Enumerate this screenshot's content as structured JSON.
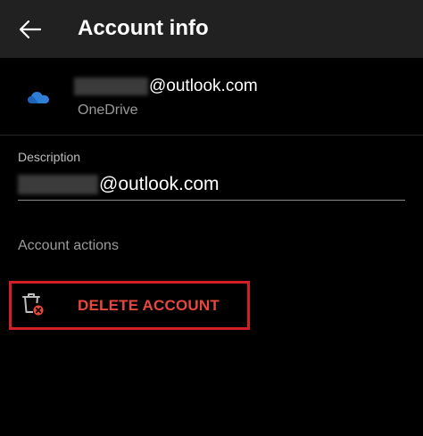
{
  "app_bar": {
    "title": "Account info",
    "back_icon": "arrow-left-icon"
  },
  "account": {
    "email_visible": "@outlook.com",
    "service": "OneDrive",
    "icon": "onedrive-cloud-icon",
    "icon_color": "#2f7fd6"
  },
  "description": {
    "label": "Description",
    "value_visible": "@outlook.com"
  },
  "actions": {
    "header": "Account actions",
    "delete_label": "DELETE ACCOUNT",
    "delete_icon": "trash-remove-icon",
    "delete_color": "#e8473e",
    "highlight_color": "#d21f25"
  },
  "colors": {
    "background": "#000000",
    "app_bar": "#212121",
    "text_primary": "#ffffff",
    "text_secondary": "#9a9a9a"
  }
}
